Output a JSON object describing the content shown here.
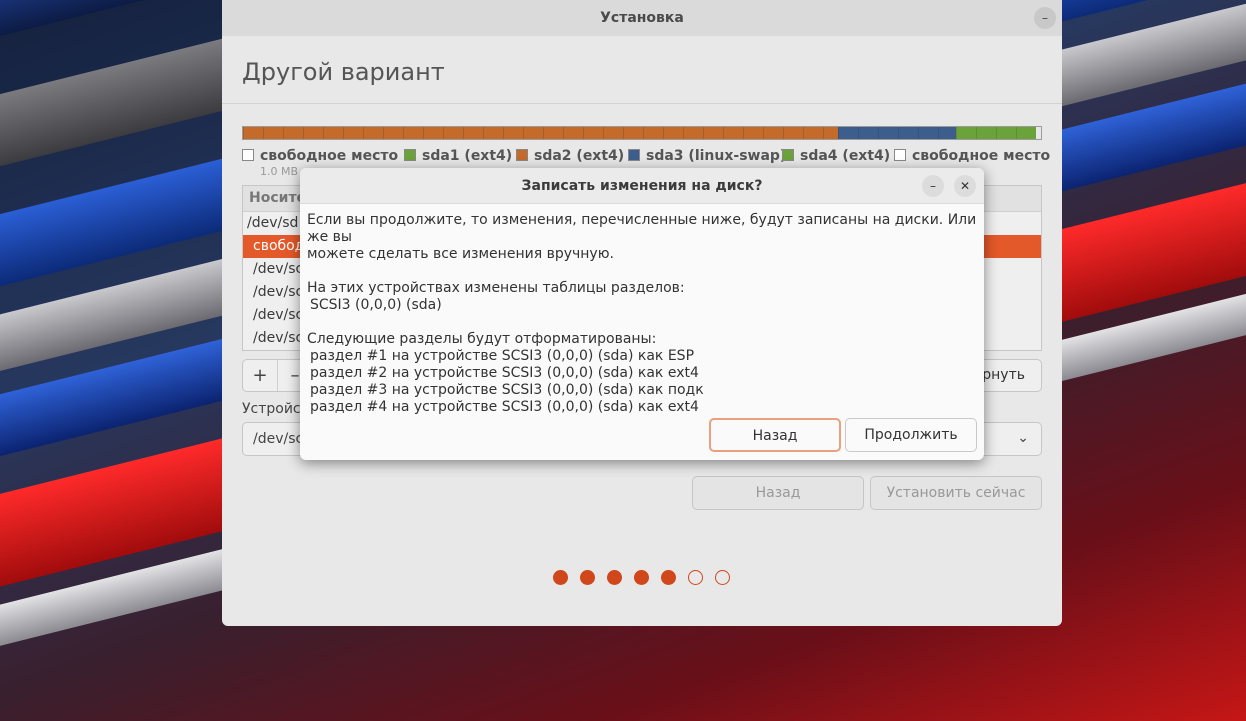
{
  "window": {
    "title": "Установка",
    "minimize_symbol": "–",
    "heading": "Другой вариант"
  },
  "partition_bar": [
    {
      "color": "#c46a2a",
      "fraction": 0.745
    },
    {
      "color": "#3d5e8c",
      "fraction": 0.148
    },
    {
      "color": "#6ba33a",
      "fraction": 0.101
    }
  ],
  "legend": [
    {
      "label": "свободное место",
      "size": "1.0 MB",
      "color": "#ffffff"
    },
    {
      "label": "sda1 (ext4)",
      "size": "",
      "color": "#6ba33a"
    },
    {
      "label": "sda2 (ext4)",
      "size": "",
      "color": "#c46a2a"
    },
    {
      "label": "sda3 (linux-swap)",
      "size": "",
      "color": "#3d5e8c"
    },
    {
      "label": "sda4 (ext4)",
      "size": "",
      "color": "#6ba33a"
    },
    {
      "label": "свободное место",
      "size": "",
      "color": "#ffffff"
    }
  ],
  "table": {
    "header": "Носите",
    "rows": [
      "/dev/sd",
      "свобод",
      "/dev/sc",
      "/dev/sc",
      "/dev/sc",
      "/dev/sc"
    ]
  },
  "controls": {
    "add": "+",
    "remove": "–",
    "revert": "рнуть",
    "device_label": "Устройс",
    "device_value": "/dev/sc",
    "back": "Назад",
    "install_now": "Установить сейчас"
  },
  "progress": {
    "total": 7,
    "completed": 5
  },
  "dialog": {
    "title": "Записать изменения на диск?",
    "minimize_symbol": "–",
    "close_symbol": "✕",
    "intro_line1": "Если вы продолжите, то изменения, перечисленные ниже, будут записаны на диски. Или же вы",
    "intro_line2": "можете сделать все изменения вручную.",
    "tables_heading": "На этих устройствах изменены таблицы разделов:",
    "tables_device": "SCSI3 (0,0,0) (sda)",
    "format_heading": "Следующие разделы будут отформатированы:",
    "format_items": [
      "раздел #1 на устройстве SCSI3 (0,0,0) (sda) как ESP",
      "раздел #2 на устройстве SCSI3 (0,0,0) (sda) как ext4",
      "раздел #3 на устройстве SCSI3 (0,0,0) (sda) как подк",
      "раздел #4 на устройстве SCSI3 (0,0,0) (sda) как ext4"
    ],
    "back_button": "Назад",
    "continue_button": "Продолжить"
  }
}
